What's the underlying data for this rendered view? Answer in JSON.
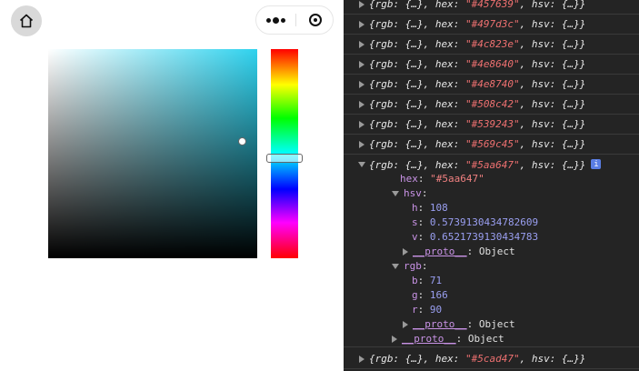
{
  "colors": {
    "sv_hue_color": "#2fd2ee",
    "console_bg": "#242424",
    "hex_string_color": "#ee7070"
  },
  "picker": {
    "home_icon": "home-icon",
    "more_icon": "more-dots-icon",
    "close_icon": "target-close-icon",
    "hue_position_fraction": 0.52,
    "saturation_fraction": 0.93,
    "value_fraction": 0.56
  },
  "console": {
    "collapsed_before": [
      {
        "prefix": "{rgb: {…}, hex: ",
        "hex": "\"#457639\"",
        "suffix": ", hsv: {…}}"
      },
      {
        "prefix": "{rgb: {…}, hex: ",
        "hex": "\"#497d3c\"",
        "suffix": ", hsv: {…}}"
      },
      {
        "prefix": "{rgb: {…}, hex: ",
        "hex": "\"#4c823e\"",
        "suffix": ", hsv: {…}}"
      },
      {
        "prefix": "{rgb: {…}, hex: ",
        "hex": "\"#4e8640\"",
        "suffix": ", hsv: {…}}"
      },
      {
        "prefix": "{rgb: {…}, hex: ",
        "hex": "\"#4e8740\"",
        "suffix": ", hsv: {…}}"
      },
      {
        "prefix": "{rgb: {…}, hex: ",
        "hex": "\"#508c42\"",
        "suffix": ", hsv: {…}}"
      },
      {
        "prefix": "{rgb: {…}, hex: ",
        "hex": "\"#539243\"",
        "suffix": ", hsv: {…}}"
      },
      {
        "prefix": "{rgb: {…}, hex: ",
        "hex": "\"#569c45\"",
        "suffix": ", hsv: {…}}"
      }
    ],
    "expanded": {
      "prefix": "{rgb: {…}, hex: ",
      "hex": "\"#5aa647\"",
      "suffix": ", hsv: {…}}",
      "info": "i",
      "hex_key": "hex",
      "hex_value": "\"#5aa647\"",
      "hsv_key": "hsv",
      "h_key": "h",
      "h_value": "108",
      "s_key": "s",
      "s_value": "0.5739130434782609",
      "v_key": "v",
      "v_value": "0.6521739130434783",
      "proto_key": "__proto__",
      "proto_value": "Object",
      "rgb_key": "rgb",
      "b_key": "b",
      "b_value": "71",
      "g_key": "g",
      "g_value": "166",
      "r_key": "r",
      "r_value": "90"
    },
    "collapsed_after": [
      {
        "prefix": "{rgb: {…}, hex: ",
        "hex": "\"#5cad47\"",
        "suffix": ", hsv: {…}}"
      }
    ]
  }
}
